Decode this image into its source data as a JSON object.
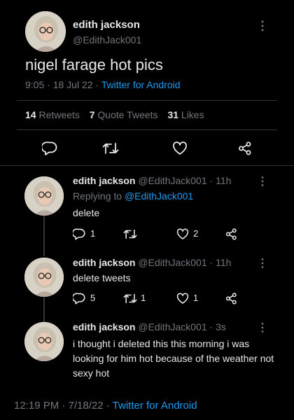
{
  "main_tweet": {
    "author_name": "edith jackson",
    "author_handle": "@EdithJack001",
    "text": "nigel farage hot pics",
    "time": "9:05 · 18 Jul 22 ·",
    "source": "Twitter for Android",
    "stats": {
      "retweets_count": "14",
      "retweets_label": "Retweets",
      "quotes_count": "7",
      "quotes_label": "Quote Tweets",
      "likes_count": "31",
      "likes_label": "Likes"
    }
  },
  "replies": [
    {
      "author_name": "edith jackson",
      "meta": "@EdithJack001 · 11h",
      "replying_prefix": "Replying to",
      "replying_handle": "@EdithJack001",
      "text": "delete",
      "reply_count": "1",
      "retweet_count": "",
      "like_count": "2"
    },
    {
      "author_name": "edith jackson",
      "meta": "@EdithJack001 · 11h",
      "text": "delete tweets",
      "reply_count": "5",
      "retweet_count": "1",
      "like_count": "1"
    },
    {
      "author_name": "edith jackson",
      "meta": "@EdithJack001 · 3s",
      "text": "i thought i deleted this this morning i was looking for him hot because of the weather not sexy hot"
    }
  ],
  "footer": {
    "time": "12:19 PM · 7/18/22 ·",
    "source": "Twitter for Android"
  },
  "colors": {
    "background": "#000000",
    "text": "#e7e9ea",
    "muted": "#71767b",
    "link": "#1d9bf0"
  }
}
